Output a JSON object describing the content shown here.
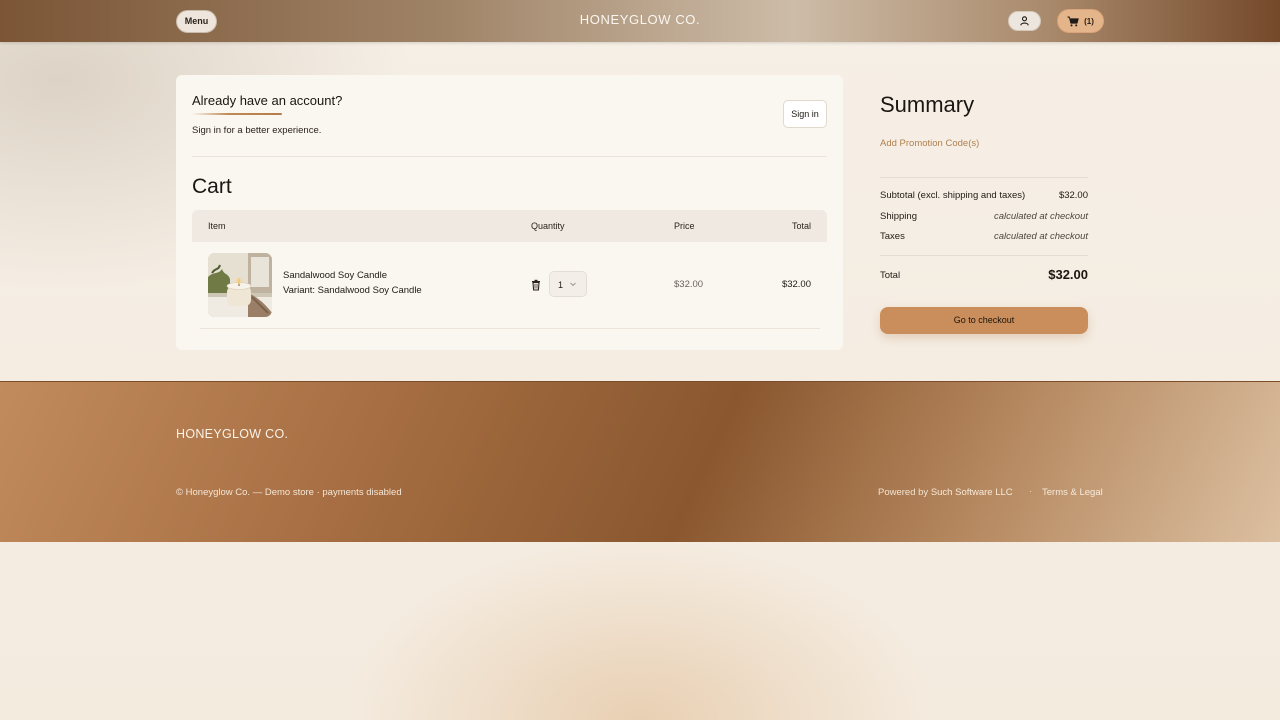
{
  "header": {
    "menu_label": "Menu",
    "brand": "HONEYGLOW CO.",
    "cart_count": "(1)",
    "account_icon": "user-icon",
    "cart_icon": "cart-icon"
  },
  "account": {
    "title": "Already have an account?",
    "subtitle": "Sign in for a better experience.",
    "sign_in_label": "Sign in"
  },
  "cart": {
    "title": "Cart",
    "columns": {
      "item": "Item",
      "quantity": "Quantity",
      "price": "Price",
      "total": "Total"
    },
    "items": [
      {
        "name": "Sandalwood Soy Candle",
        "variant": "Variant: Sandalwood Soy Candle",
        "quantity": "1",
        "price": "$32.00",
        "total": "$32.00"
      }
    ]
  },
  "summary": {
    "title": "Summary",
    "promo_link": "Add Promotion Code(s)",
    "subtotal_label": "Subtotal (excl. shipping and taxes)",
    "subtotal_value": "$32.00",
    "shipping_label": "Shipping",
    "shipping_value": "calculated at checkout",
    "taxes_label": "Taxes",
    "taxes_value": "calculated at checkout",
    "total_label": "Total",
    "total_value": "$32.00",
    "checkout_label": "Go to checkout"
  },
  "footer": {
    "brand": "HONEYGLOW CO.",
    "copyright": "© Honeyglow Co. — Demo store · payments disabled",
    "powered_prefix": "Powered by ",
    "powered_link": "Such Software LLC",
    "separator": "·",
    "terms": "Terms & Legal"
  },
  "colors": {
    "accent": "#c98e5c",
    "promo_link": "#b0804f",
    "footer_brown": "#8a572f"
  }
}
